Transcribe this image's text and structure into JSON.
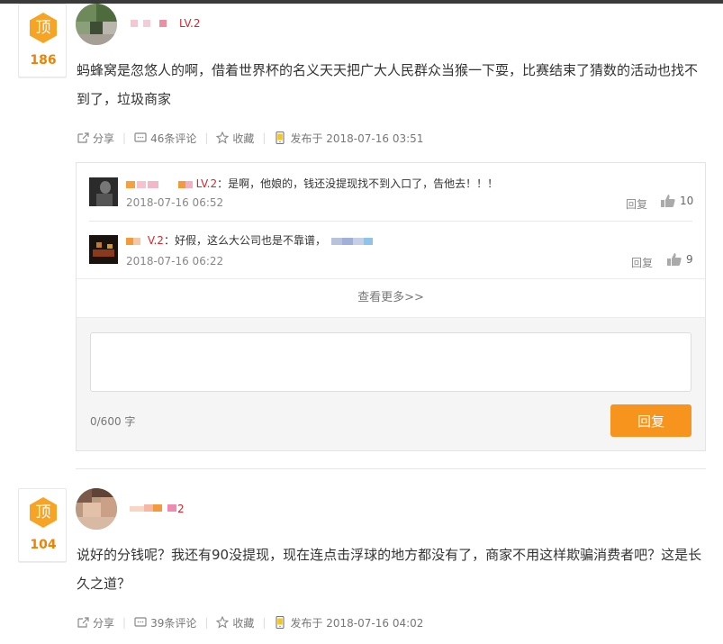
{
  "comments": [
    {
      "votes": {
        "label": "顶",
        "count": "186"
      },
      "level": "LV.2",
      "text": "蚂蜂窝是忽悠人的啊，借着世界杯的名义天天把广大人民群众当猴一下耍，比赛结束了猜数的活动也找不到了，垃圾商家",
      "actions": {
        "share": "分享",
        "comments": "46条评论",
        "favorite": "收藏",
        "published": "发布于 2018-07-16 03:51"
      },
      "replies": [
        {
          "level": "LV.2",
          "text": "：是啊，他娘的，钱还没提现找不到入口了，告他去！！！",
          "time": "2018-07-16 06:52",
          "reply_label": "回复",
          "likes": "10"
        },
        {
          "level": "V.2",
          "text": "：好假，这么大公司也是不靠谱，",
          "time": "2018-07-16 06:22",
          "reply_label": "回复",
          "likes": "9"
        }
      ],
      "more_label": "查看更多>>",
      "editor": {
        "placeholder": "",
        "char_count": "0/600 字",
        "submit_label": "回复"
      }
    },
    {
      "votes": {
        "label": "顶",
        "count": "104"
      },
      "level": "2",
      "text": "说好的分钱呢？我还有90没提现，现在连点击浮球的地方都没有了，商家不用这样欺骗消费者吧？这是长久之道？",
      "actions": {
        "share": "分享",
        "comments": "39条评论",
        "favorite": "收藏",
        "published": "发布于 2018-07-16 04:02"
      }
    }
  ],
  "colors": {
    "accent": "#f7941d",
    "level_red": "#d9262c",
    "vote_count": "#f08200"
  }
}
